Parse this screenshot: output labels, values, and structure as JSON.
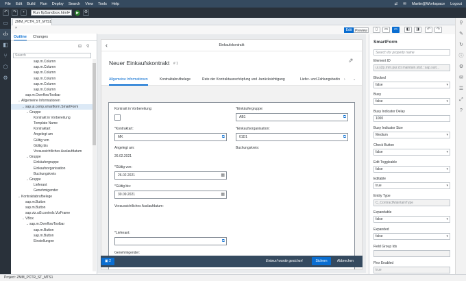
{
  "menu": [
    "File",
    "Edit",
    "Build",
    "Run",
    "Deploy",
    "Search",
    "View",
    "Tools",
    "Help"
  ],
  "user": "Martin@Workspace",
  "logout": "Logout",
  "run_config": "Run flpSandbox.html",
  "editor_tab": "ZMM_PCTR_ST_MTS1",
  "outline": {
    "tabs": [
      "Outline",
      "Changes"
    ],
    "search_placeholder": "Search",
    "tree": [
      {
        "label": "sap.m.Column",
        "indent": 4
      },
      {
        "label": "sap.m.Column",
        "indent": 4
      },
      {
        "label": "sap.m.Column",
        "indent": 4
      },
      {
        "label": "sap.m.Column",
        "indent": 4
      },
      {
        "label": "sap.m.Column",
        "indent": 4
      },
      {
        "label": "sap.m.Column",
        "indent": 4
      },
      {
        "label": "sap.m.OverflowToolbar",
        "indent": 2
      },
      {
        "label": "Allgemeine Informationen",
        "indent": 1,
        "caret": "⌄"
      },
      {
        "label": "sap.ui.comp.smartform.SmartForm",
        "indent": 2,
        "caret": "⌄",
        "selected": true
      },
      {
        "label": "Gruppe",
        "indent": 3,
        "caret": "⌄"
      },
      {
        "label": "Kontrakt in Vorbereitung",
        "indent": 4
      },
      {
        "label": "Template Name",
        "indent": 4
      },
      {
        "label": "Kontraktart",
        "indent": 4
      },
      {
        "label": "Angelegt am",
        "indent": 4
      },
      {
        "label": "Gültig von",
        "indent": 4
      },
      {
        "label": "Gültig bis",
        "indent": 4
      },
      {
        "label": "Voraussichtliches Auslaufdatum",
        "indent": 4
      },
      {
        "label": "Gruppe",
        "indent": 3,
        "caret": "⌄"
      },
      {
        "label": "Einkäufergruppe",
        "indent": 4
      },
      {
        "label": "Einkaufsorganisation",
        "indent": 4
      },
      {
        "label": "Buchungskreis",
        "indent": 4
      },
      {
        "label": "Gruppe",
        "indent": 3,
        "caret": "⌄"
      },
      {
        "label": "Lieferant",
        "indent": 4
      },
      {
        "label": "Genehmigender",
        "indent": 4
      },
      {
        "label": "Kontraktabrufbelege",
        "indent": 1,
        "caret": "⌄"
      },
      {
        "label": "sap.m.Button",
        "indent": 2
      },
      {
        "label": "sap.m.Button",
        "indent": 2
      },
      {
        "label": "sap.viz.ui5.controls.VizFrame",
        "indent": 2
      },
      {
        "label": "VBox",
        "indent": 2,
        "caret": "⌄"
      },
      {
        "label": "sap.m.OverflowToolbar",
        "indent": 3,
        "caret": "⌄"
      },
      {
        "label": "sap.m.Button",
        "indent": 4
      },
      {
        "label": "sap.m.Button",
        "indent": 4
      },
      {
        "label": "Einstellungen",
        "indent": 4
      }
    ]
  },
  "canvas": {
    "edit_label": "Edit",
    "preview_label": "Preview"
  },
  "app": {
    "header_title": "Einkaufskontrakt",
    "page_title": "Neuer Einkaufskontrakt",
    "count": "# 1",
    "tabs": [
      "Allgemeine Informationen",
      "Kontraktabrufbelege",
      "Rate der Kontraktausschöpfung und -berücksichtigung",
      "Liefer- und Zahlungsbedin"
    ],
    "form": {
      "kontrakt_vorb_label": "Kontrakt in Vorbereitung:",
      "einkaeufergruppe_label": "*Einkäufergruppe:",
      "einkaeufergruppe_value": "AB1",
      "kontraktart_label": "*Kontraktart:",
      "kontraktart_value": "MK",
      "einkaufsorg_label": "*Einkaufsorganisation:",
      "einkaufsorg_value": "01D1",
      "angelegt_label": "Angelegt am:",
      "angelegt_value": "26.02.2021",
      "buchungskreis_label": "Buchungskreis:",
      "gueltig_von_label": "*Gültig von:",
      "gueltig_von_value": "26.02.2021",
      "gueltig_bis_label": "*Gültig bis:",
      "gueltig_bis_value": "30.09.2021",
      "auslauf_label": "Voraussichtliches Auslaufdatum:",
      "lieferant_label": "*Lieferant:",
      "genehmigender_label": "Genehmigender:"
    },
    "footer": {
      "messages": "2",
      "saved": "Entwurf wurde gesichert",
      "save": "Sichern",
      "cancel": "Abbrechen"
    }
  },
  "properties": {
    "title": "SmartForm",
    "search_placeholder": "Search for property name",
    "items": [
      {
        "label": "Element ID",
        "value": "ui.s2p.mm.pur.ctr.maintain.sts1::sap.suit...",
        "readonly": true
      },
      {
        "label": "Blocked",
        "value": "false",
        "select": true
      },
      {
        "label": "Busy",
        "value": "false",
        "select": true
      },
      {
        "label": "Busy Indicator Delay",
        "value": "1000"
      },
      {
        "label": "Busy Indicator Size",
        "value": "Medium",
        "select": true
      },
      {
        "label": "Check Button",
        "value": "false",
        "select": true
      },
      {
        "label": "Edit Toggleable",
        "value": "false",
        "select": true
      },
      {
        "label": "Editable",
        "value": "true",
        "select": true
      },
      {
        "label": "Entity Type",
        "value": "C_ContractMaintainType",
        "readonly": true
      },
      {
        "label": "Expandable",
        "value": "false",
        "select": true
      },
      {
        "label": "Expanded",
        "value": "false",
        "select": true
      },
      {
        "label": "Field Group Ids",
        "value": "",
        "readonly": true
      },
      {
        "label": "Flex Enabled",
        "value": "true",
        "readonly": true
      }
    ]
  },
  "status": "Project:  ZMM_PCTR_ST_MTS1"
}
